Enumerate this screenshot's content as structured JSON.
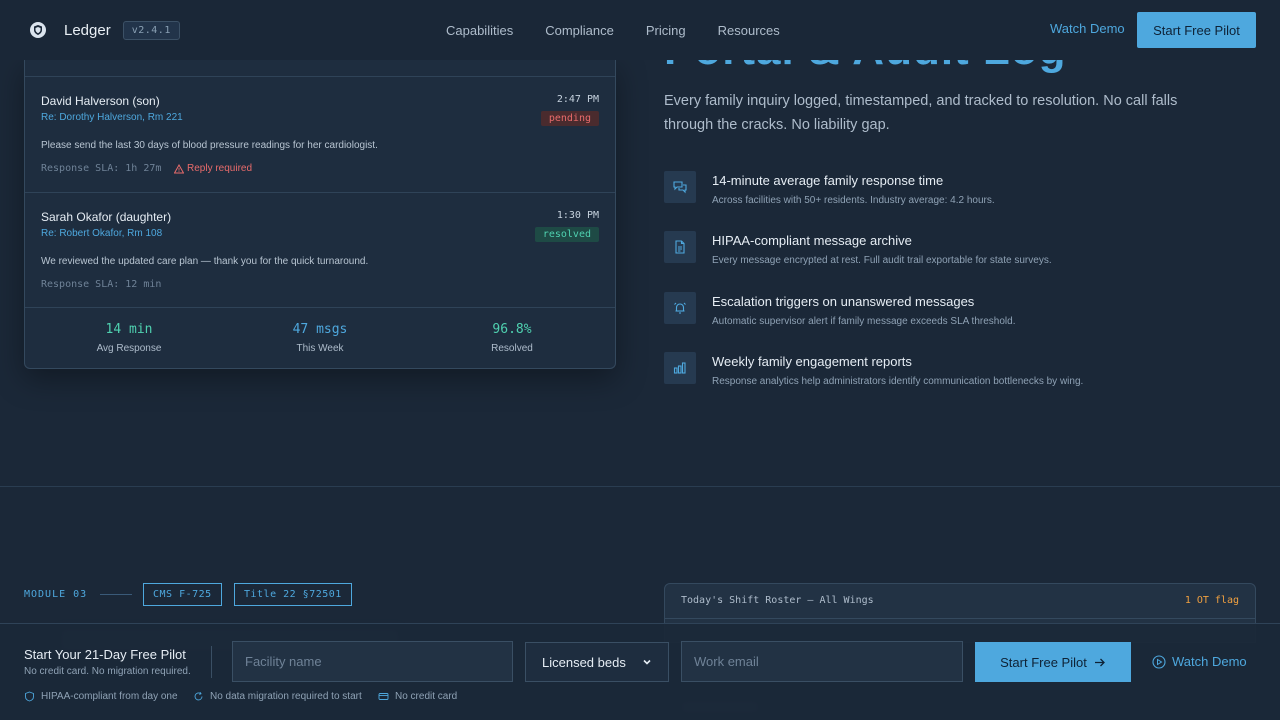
{
  "nav": {
    "brand": "Ledger",
    "version": "v2.4.1",
    "links": [
      "Capabilities",
      "Compliance",
      "Pricing",
      "Resources"
    ],
    "watch_demo": "Watch Demo",
    "cta": "Start Free Pilot"
  },
  "hero": {
    "heading_fragment": "Portal & Audit Log",
    "lead": "Every family inquiry logged, timestamped, and tracked to resolution. No call falls through the cracks. No liability gap."
  },
  "messages": [
    {
      "name": "David Halverson (son)",
      "regarding": "Re: Dorothy Halverson, Rm 221",
      "time": "2:47 PM",
      "status": "pending",
      "body": "Please send the last 30 days of blood pressure readings for her cardiologist.",
      "sla": "Response SLA: 1h 27m",
      "alert": "Reply required"
    },
    {
      "name": "Sarah Okafor (daughter)",
      "regarding": "Re: Robert Okafor, Rm 108",
      "time": "1:30 PM",
      "status": "resolved",
      "body": "We reviewed the updated care plan — thank you for the quick turnaround.",
      "sla": "Response SLA: 12 min"
    }
  ],
  "stats": [
    {
      "value": "14 min",
      "label": "Avg Response"
    },
    {
      "value": "47 msgs",
      "label": "This Week"
    },
    {
      "value": "96.8%",
      "label": "Resolved"
    }
  ],
  "features": [
    {
      "icon": "chat-bubbles-icon",
      "title": "14-minute average family response time",
      "desc": "Across facilities with 50+ residents. Industry average: 4.2 hours."
    },
    {
      "icon": "document-icon",
      "title": "HIPAA-compliant message archive",
      "desc": "Every message encrypted at rest. Full audit trail exportable for state surveys."
    },
    {
      "icon": "alarm-bell-icon",
      "title": "Escalation triggers on unanswered messages",
      "desc": "Automatic supervisor alert if family message exceeds SLA threshold."
    },
    {
      "icon": "bar-chart-icon",
      "title": "Weekly family engagement reports",
      "desc": "Response analytics help administrators identify communication bottlenecks by wing."
    }
  ],
  "module": {
    "tag": "MODULE 03",
    "chips": [
      "CMS F-725",
      "Title 22 §72501"
    ]
  },
  "roster": {
    "title": "Today's Shift Roster — All Wings",
    "flag": "1 OT flag"
  },
  "bottom_bar": {
    "title": "Start Your 21-Day Free Pilot",
    "subtitle": "No credit card. No migration required.",
    "facility_placeholder": "Facility name",
    "beds_selected": "Licensed beds",
    "email_placeholder": "Work email",
    "cta": "Start Free Pilot",
    "watch_demo": "Watch Demo",
    "trust": [
      "HIPAA-compliant from day one",
      "No data migration required to start",
      "No credit card"
    ]
  }
}
